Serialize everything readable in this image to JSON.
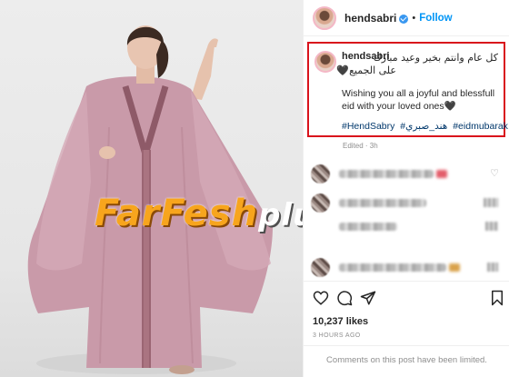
{
  "post": {
    "username": "hendsabri",
    "follow_label": "Follow",
    "separator": "•"
  },
  "caption": {
    "username": "hendsabri",
    "arabic_line1": "كل عام وانتم بخير وعيد مبارك",
    "arabic_line2": "على الجميع🖤",
    "english": "Wishing you all a joyful and blessfull eid with your loved ones🖤",
    "hashtags": [
      "#HendSabry",
      "#هند_صبري",
      "#eidmubarak"
    ],
    "edited": "Edited · 3h"
  },
  "watermark": {
    "main": "FarFesh",
    "tail": "plus.com"
  },
  "actions": {
    "like_icon": "heart-icon",
    "comment_icon": "comment-icon",
    "share_icon": "share-icon",
    "save_icon": "bookmark-icon"
  },
  "stats": {
    "likes": "10,237 likes",
    "time": "3 HOURS AGO",
    "comments_limited": "Comments on this post have been limited."
  },
  "colors": {
    "accent_blue": "#0095f6",
    "highlight_red": "#d9131c",
    "dress_pink": "#c99aa9",
    "watermark_orange": "#f7a51d"
  }
}
